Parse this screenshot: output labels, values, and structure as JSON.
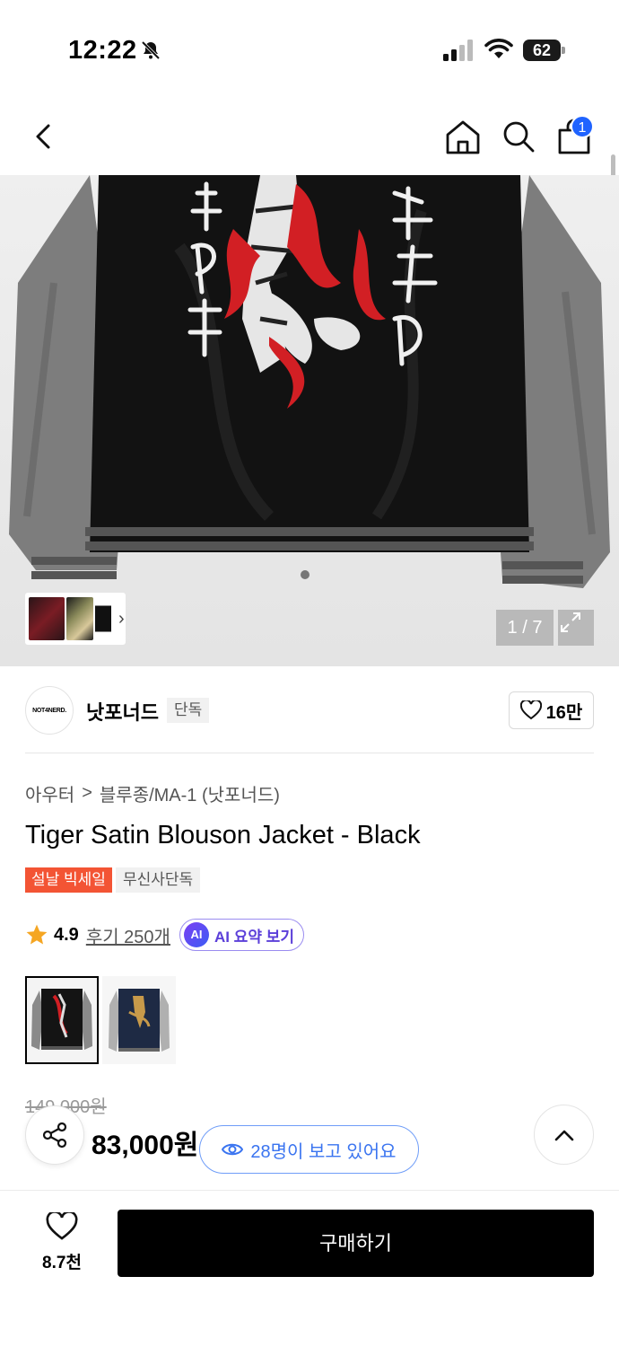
{
  "status_bar": {
    "time": "12:22",
    "battery": "62"
  },
  "nav": {
    "cart_count": "1"
  },
  "gallery": {
    "counter": "1 / 7"
  },
  "brand": {
    "logo_text": "NOT4NERD.",
    "name": "낫포너드",
    "tag": "단독",
    "likes": "16만"
  },
  "breadcrumb": {
    "category": "아우터",
    "separator": ">",
    "subcategory": "블루종/MA-1 (낫포너드)"
  },
  "product": {
    "title": "Tiger Satin Blouson Jacket - Black",
    "tags": [
      "설날 빅세일",
      "무신사단독"
    ],
    "rating": "4.9",
    "reviews": "후기 250개",
    "ai_badge": "AI",
    "ai_summary": "AI 요약 보기",
    "price_original": "149,000원",
    "price_current": "83,000원"
  },
  "viewers": {
    "text": "28명이 보고 있어요"
  },
  "bottom_bar": {
    "like_count": "8.7천",
    "buy_label": "구매하기"
  },
  "colors": {
    "accent_blue": "#1f63ff",
    "sale_red": "#f35434",
    "ai_purple": "#5b3fd9"
  }
}
